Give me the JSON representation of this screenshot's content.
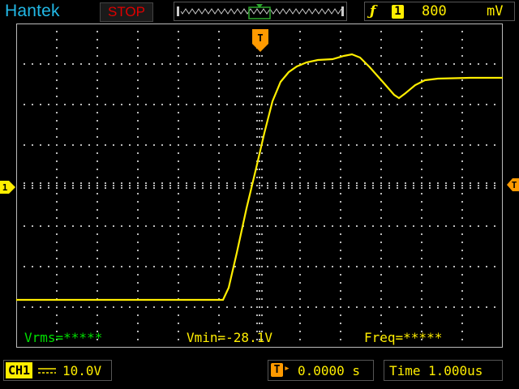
{
  "header": {
    "brand": "Hantek",
    "run_state": "STOP",
    "trigger": {
      "icon": "trigger-edge-icon",
      "source": "1",
      "level": "800",
      "unit": "mV"
    }
  },
  "markers": {
    "channel": "1",
    "trigger_time": "T"
  },
  "measurements": {
    "vrms": "Vrms=*****",
    "vmin": "Vmin=-28.1V",
    "freq": "Freq=*****"
  },
  "footer": {
    "channel_label": "CH1",
    "coupling_icon": "dc-coupling-icon",
    "volts_div": "10.0V",
    "trigger_pos": "0.0000 s",
    "timebase_label": "Time",
    "timebase_value": "1.000us"
  },
  "colors": {
    "trace": "#ffee00",
    "grid": "#bbbbbb",
    "brand": "#22b8e6",
    "stop": "#e00000",
    "marker": "#ff9a00",
    "measure_green": "#00e000"
  }
}
